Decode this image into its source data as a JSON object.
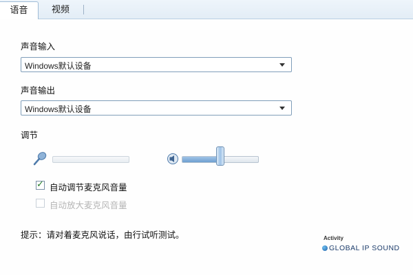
{
  "tabs": [
    {
      "label": "语音",
      "active": true
    },
    {
      "label": "视频",
      "active": false
    }
  ],
  "input_section": {
    "label": "声音输入",
    "device_value": "Windows默认设备"
  },
  "output_section": {
    "label": "声音输出",
    "device_value": "Windows默认设备"
  },
  "adjust_section": {
    "label": "调节",
    "mic_slider": {
      "icon": "microphone-icon",
      "level": 0.0,
      "enabled": false
    },
    "speaker_slider": {
      "icon": "speaker-icon",
      "level": 0.5,
      "enabled": true
    }
  },
  "checkboxes": [
    {
      "label": "自动调节麦克风音量",
      "checked": true,
      "enabled": true
    },
    {
      "label": "自动放大麦克风音量",
      "checked": false,
      "enabled": false
    }
  ],
  "tip": "提示：请对着麦克风说话，由行试听测试。",
  "logo": {
    "powered": "Activity",
    "brand": "GLOBAL IP SOUND"
  },
  "colors": {
    "tab_strip": "#e3edf6",
    "border": "#7f9db9",
    "slider_fill": "#6e9fd0",
    "check_mark": "#1f7a24"
  }
}
